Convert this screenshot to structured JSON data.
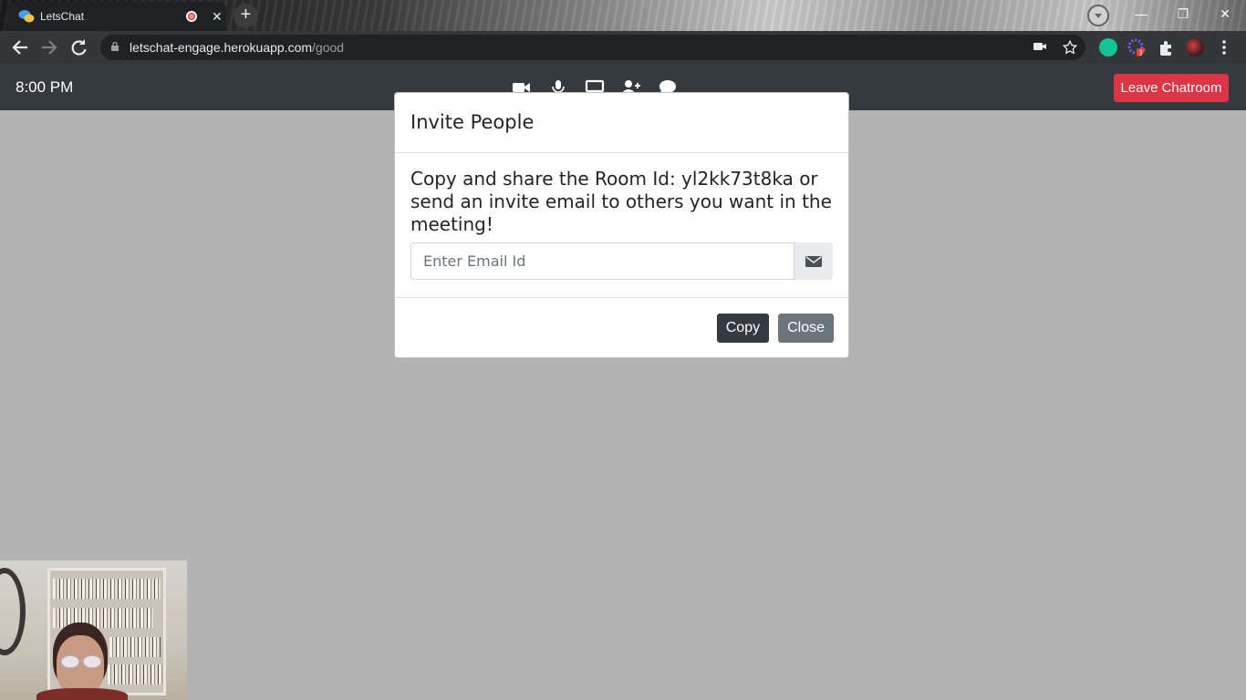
{
  "browser": {
    "tab_title": "LetsChat",
    "tab_close": "✕",
    "new_tab": "+",
    "url_host": "letschat-engage.herokuapp.com",
    "url_path": "/good",
    "window_controls": [
      "—",
      "❐",
      "✕"
    ],
    "extension_badge": "1"
  },
  "header": {
    "time": "8:00 PM",
    "controls": [
      "video-camera-icon",
      "microphone-icon",
      "screen-share-icon",
      "add-person-icon",
      "chat-icon"
    ],
    "leave_label": "Leave Chatroom"
  },
  "modal": {
    "title": "Invite People",
    "message": "Copy and share the Room Id: yl2kk73t8ka or send an invite email to others you want in the meeting!",
    "email_placeholder": "Enter Email Id",
    "copy_label": "Copy",
    "close_label": "Close"
  },
  "colors": {
    "header_bg": "#343a40",
    "leave_button": "#dc3545",
    "overlay_bg": "#b3b3b3",
    "copy_button": "#343a40",
    "close_button": "#6c757d"
  }
}
